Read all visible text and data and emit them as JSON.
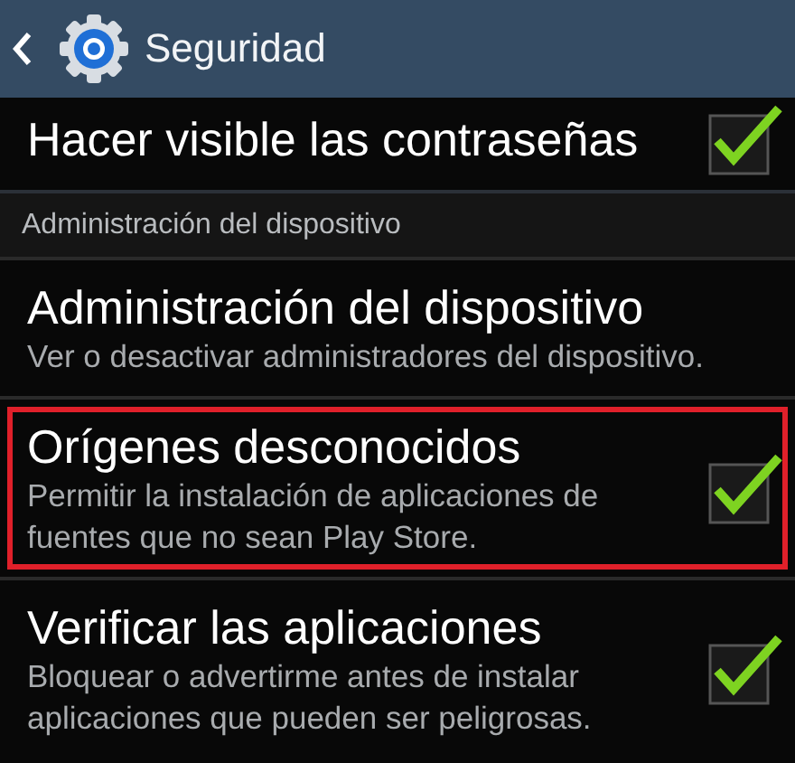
{
  "header": {
    "title": "Seguridad"
  },
  "items": [
    {
      "kind": "checkbox",
      "title": "Hacer visible las contraseñas",
      "checked": true,
      "highlighted": false
    },
    {
      "kind": "section",
      "title": "Administración del dispositivo"
    },
    {
      "kind": "plain",
      "title": "Administración del dispositivo",
      "summary": "Ver o desactivar administradores del dispositivo.",
      "highlighted": false
    },
    {
      "kind": "checkbox",
      "title": "Orígenes desconocidos",
      "summary": "Permitir la instalación de aplicaciones de fuentes que no sean Play Store.",
      "checked": true,
      "highlighted": true
    },
    {
      "kind": "checkbox",
      "title": "Verificar las aplicaciones",
      "summary": "Bloquear o advertirme antes de instalar aplicaciones que pueden ser peligrosas.",
      "checked": true,
      "highlighted": false
    }
  ]
}
